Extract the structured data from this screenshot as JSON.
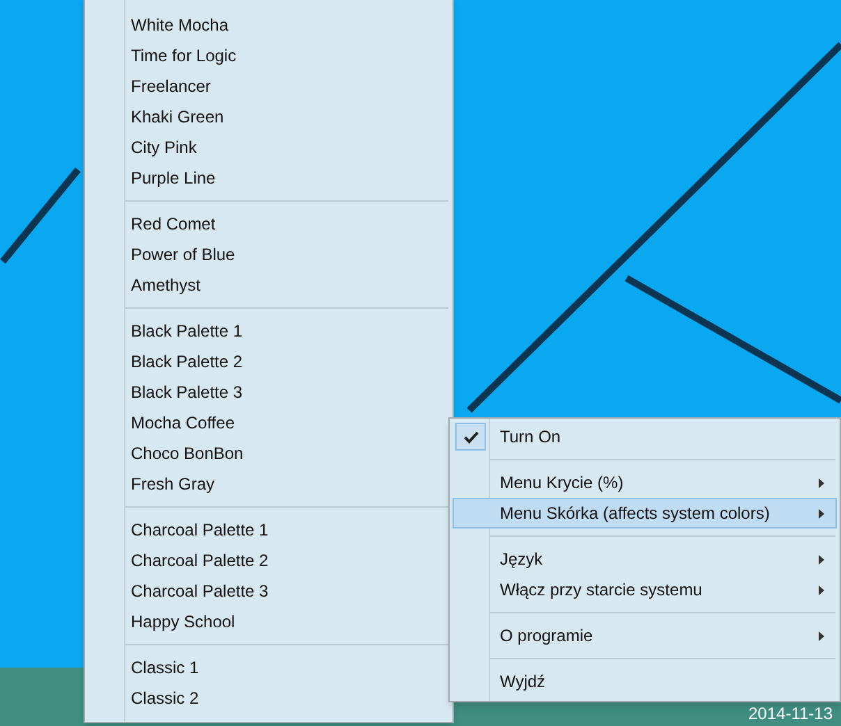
{
  "skin_menu": {
    "groups": [
      {
        "items": [
          "White Mocha",
          "Time for Logic",
          "Freelancer",
          "Khaki Green",
          "City Pink",
          "Purple Line"
        ]
      },
      {
        "items": [
          "Red Comet",
          "Power of Blue",
          "Amethyst"
        ]
      },
      {
        "items": [
          "Black Palette 1",
          "Black Palette 2",
          "Black Palette 3",
          "Mocha Coffee",
          "Choco BonBon",
          "Fresh Gray"
        ]
      },
      {
        "items": [
          "Charcoal Palette 1",
          "Charcoal Palette 2",
          "Charcoal Palette 3",
          "Happy School"
        ]
      },
      {
        "items": [
          "Classic 1",
          "Classic 2"
        ]
      }
    ]
  },
  "context_menu": {
    "groups": [
      {
        "items": [
          {
            "label": "Turn On",
            "checked": true,
            "submenu": false,
            "selected": false
          }
        ]
      },
      {
        "items": [
          {
            "label": "Menu Krycie (%)",
            "checked": false,
            "submenu": true,
            "selected": false
          },
          {
            "label": "Menu Skórka (affects system colors)",
            "checked": false,
            "submenu": true,
            "selected": true
          }
        ]
      },
      {
        "items": [
          {
            "label": "Język",
            "checked": false,
            "submenu": true,
            "selected": false
          },
          {
            "label": "Włącz przy starcie systemu",
            "checked": false,
            "submenu": true,
            "selected": false
          }
        ]
      },
      {
        "items": [
          {
            "label": "O programie",
            "checked": false,
            "submenu": true,
            "selected": false
          }
        ]
      },
      {
        "items": [
          {
            "label": "Wyjdź",
            "checked": false,
            "submenu": false,
            "selected": false
          }
        ]
      }
    ]
  },
  "taskbar": {
    "date": "2014-11-13"
  }
}
